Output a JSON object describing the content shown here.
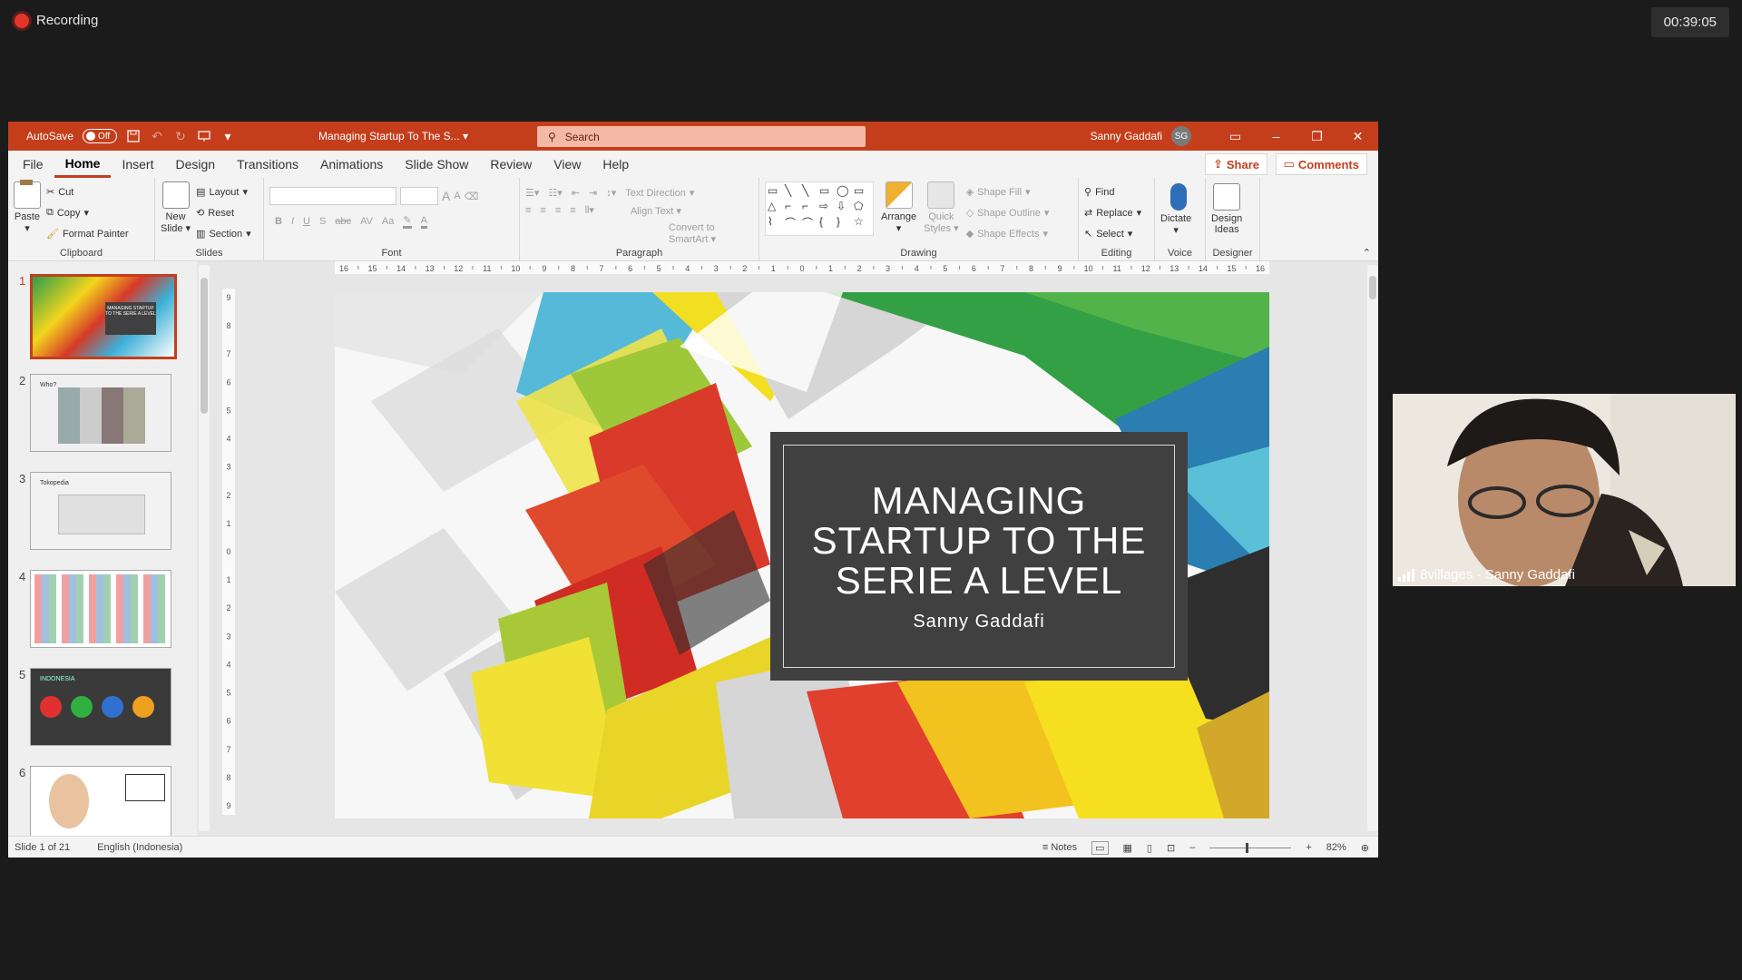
{
  "meeting": {
    "recording_label": "Recording",
    "timer": "00:39:05",
    "camera_label": "8villages - Sanny Gaddafi"
  },
  "titlebar": {
    "autosave_label": "AutoSave",
    "autosave_state": "Off",
    "doc_title": "Managing Startup To The S...",
    "search_placeholder": "Search",
    "user_name": "Sanny Gaddafi",
    "user_initials": "SG"
  },
  "tabs": [
    "File",
    "Home",
    "Insert",
    "Design",
    "Transitions",
    "Animations",
    "Slide Show",
    "Review",
    "View",
    "Help"
  ],
  "active_tab": "Home",
  "share_label": "Share",
  "comments_label": "Comments",
  "ribbon": {
    "clipboard": {
      "label": "Clipboard",
      "paste": "Paste",
      "cut": "Cut",
      "copy": "Copy",
      "format_painter": "Format Painter"
    },
    "slides": {
      "label": "Slides",
      "new_slide_1": "New",
      "new_slide_2": "Slide",
      "layout": "Layout",
      "reset": "Reset",
      "section": "Section"
    },
    "font": {
      "label": "Font",
      "increase": "A",
      "decrease": "A",
      "bold": "B",
      "italic": "I",
      "underline": "U",
      "strike": "S",
      "spacing": "AV",
      "case": "Aa",
      "color": "A"
    },
    "paragraph": {
      "label": "Paragraph",
      "text_direction": "Text Direction",
      "align_text": "Align Text",
      "convert_smartart": "Convert to SmartArt"
    },
    "drawing": {
      "label": "Drawing",
      "arrange": "Arrange",
      "quick_styles_1": "Quick",
      "quick_styles_2": "Styles",
      "shape_fill": "Shape Fill",
      "shape_outline": "Shape Outline",
      "shape_effects": "Shape Effects"
    },
    "editing": {
      "label": "Editing",
      "find": "Find",
      "replace": "Replace",
      "select": "Select"
    },
    "voice": {
      "label": "Voice",
      "dictate": "Dictate"
    },
    "designer": {
      "label": "Designer",
      "design_ideas_1": "Design",
      "design_ideas_2": "Ideas"
    }
  },
  "thumbnails": [
    {
      "num": "1",
      "title": "MANAGING STARTUP TO THE SERIE A LEVEL"
    },
    {
      "num": "2",
      "title": "Who?"
    },
    {
      "num": "3",
      "title": "Tokopedia"
    },
    {
      "num": "4",
      "title": ""
    },
    {
      "num": "5",
      "title": "INDONESIA"
    },
    {
      "num": "6",
      "title": ""
    }
  ],
  "slide": {
    "title_line1": "MANAGING",
    "title_line2": "STARTUP TO THE",
    "title_line3": "SERIE A LEVEL",
    "subtitle": "Sanny Gaddafi"
  },
  "status": {
    "slide_of": "Slide 1 of 21",
    "language": "English (Indonesia)",
    "notes": "Notes",
    "zoom": "82%"
  },
  "ruler": {
    "h_ticks": [
      "16",
      "15",
      "14",
      "13",
      "12",
      "11",
      "10",
      "9",
      "8",
      "7",
      "6",
      "5",
      "4",
      "3",
      "2",
      "1",
      "0",
      "1",
      "2",
      "3",
      "4",
      "5",
      "6",
      "7",
      "8",
      "9",
      "10",
      "11",
      "12",
      "13",
      "14",
      "15",
      "16"
    ],
    "v_ticks": [
      "9",
      "8",
      "7",
      "6",
      "5",
      "4",
      "3",
      "2",
      "1",
      "0",
      "1",
      "2",
      "3",
      "4",
      "5",
      "6",
      "7",
      "8",
      "9"
    ]
  },
  "colors": {
    "accent": "#c43e1c",
    "title_box": "#404040"
  }
}
